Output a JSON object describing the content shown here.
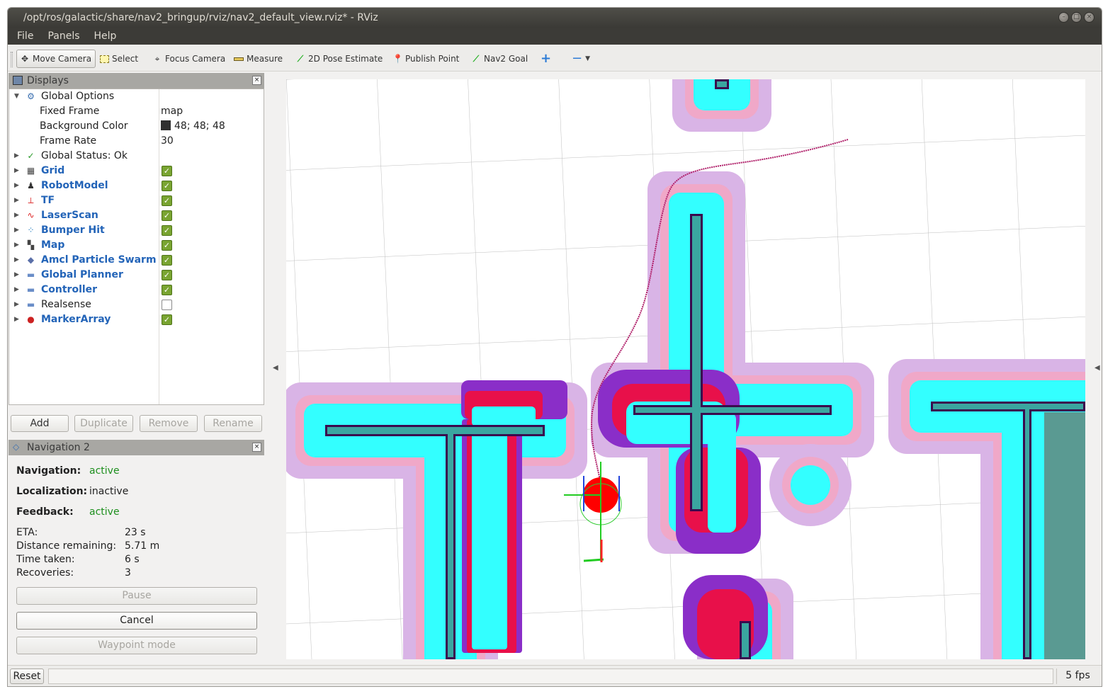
{
  "window": {
    "title": "/opt/ros/galactic/share/nav2_bringup/rviz/nav2_default_view.rviz* - RViz"
  },
  "menu": [
    "File",
    "Panels",
    "Help"
  ],
  "toolbar": {
    "move_camera": "Move Camera",
    "select": "Select",
    "focus_camera": "Focus Camera",
    "measure": "Measure",
    "pose_estimate": "2D Pose Estimate",
    "publish_point": "Publish Point",
    "nav2_goal": "Nav2 Goal"
  },
  "displays": {
    "title": "Displays",
    "global_options": "Global Options",
    "fixed_frame_label": "Fixed Frame",
    "fixed_frame_value": "map",
    "bg_color_label": "Background Color",
    "bg_color_value": "48; 48; 48",
    "bg_color_hex": "#303030",
    "frame_rate_label": "Frame Rate",
    "frame_rate_value": "30",
    "global_status": "Global Status: Ok",
    "items": [
      {
        "label": "Grid",
        "enabled": true,
        "icon": "grid-icon"
      },
      {
        "label": "RobotModel",
        "enabled": true,
        "icon": "robot-icon"
      },
      {
        "label": "TF",
        "enabled": true,
        "icon": "tf-axes-icon"
      },
      {
        "label": "LaserScan",
        "enabled": true,
        "icon": "laser-icon"
      },
      {
        "label": "Bumper Hit",
        "enabled": true,
        "icon": "points-icon"
      },
      {
        "label": "Map",
        "enabled": true,
        "icon": "map-icon"
      },
      {
        "label": "Amcl Particle Swarm",
        "enabled": true,
        "icon": "particle-icon"
      },
      {
        "label": "Global Planner",
        "enabled": true,
        "icon": "folder-icon"
      },
      {
        "label": "Controller",
        "enabled": true,
        "icon": "folder-icon"
      },
      {
        "label": "Realsense",
        "enabled": false,
        "icon": "folder-icon"
      },
      {
        "label": "MarkerArray",
        "enabled": true,
        "icon": "marker-icon"
      }
    ],
    "buttons": {
      "add": "Add",
      "duplicate": "Duplicate",
      "remove": "Remove",
      "rename": "Rename"
    }
  },
  "nav2": {
    "title": "Navigation 2",
    "navigation_label": "Navigation:",
    "navigation_value": "active",
    "localization_label": "Localization:",
    "localization_value": "inactive",
    "feedback_label": "Feedback:",
    "feedback_value": "active",
    "eta_label": "ETA:",
    "eta_value": "23 s",
    "distance_label": "Distance remaining:",
    "distance_value": "5.71 m",
    "time_label": "Time taken:",
    "time_value": "6 s",
    "recoveries_label": "Recoveries:",
    "recoveries_value": "3",
    "pause": "Pause",
    "cancel": "Cancel",
    "waypoint": "Waypoint mode"
  },
  "status": {
    "reset": "Reset",
    "fps": "5 fps"
  },
  "colors": {
    "inflation_outer": "#d9b4e6",
    "inflation_mid": "#f0a8c8",
    "inflation_inner": "#33ffff",
    "wall": "#3a0a4e",
    "wall_teal": "#3aa6a0",
    "cost_red": "#e8104a",
    "cost_purple": "#8a2ec8",
    "path": "#b0206a",
    "robot": "#ff0000"
  }
}
